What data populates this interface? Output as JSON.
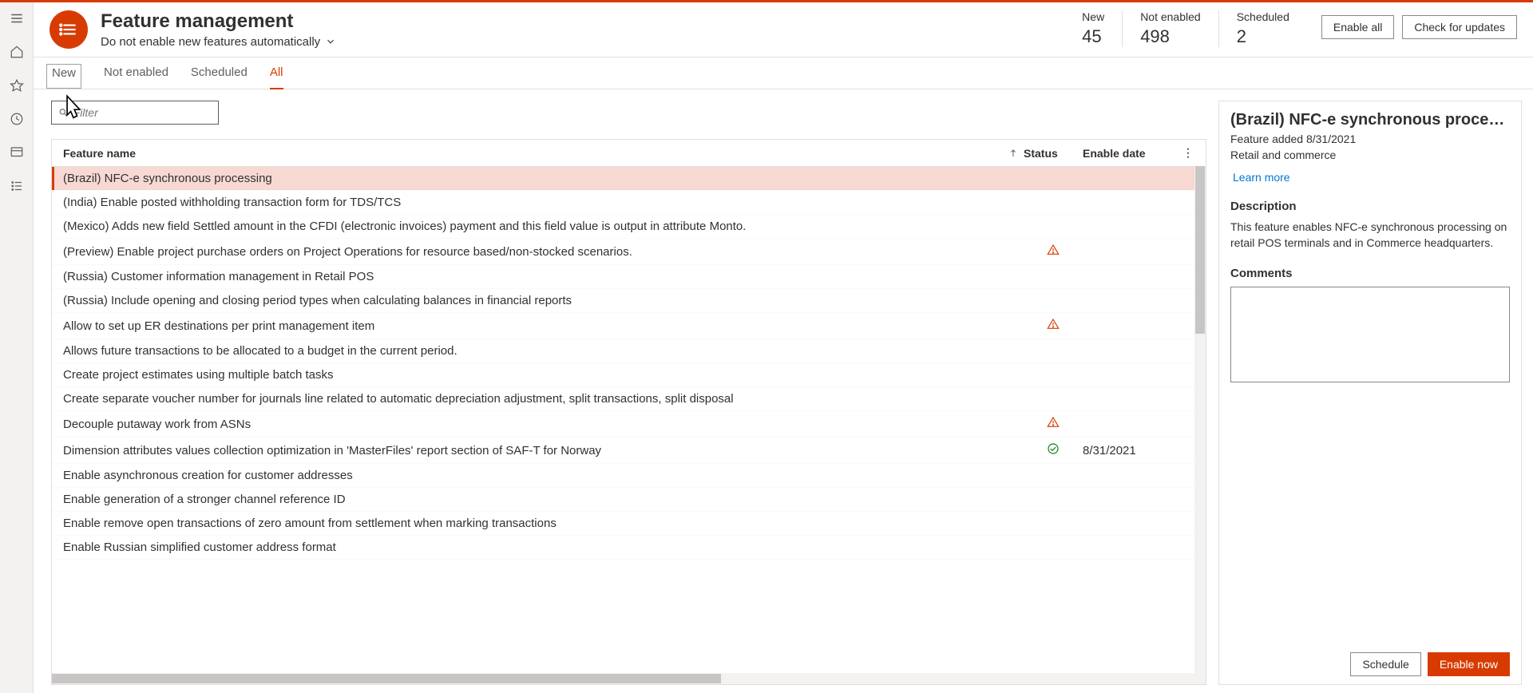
{
  "nav_rail": {
    "items": [
      "menu-icon",
      "home-icon",
      "star-icon",
      "recent-icon",
      "widget-icon",
      "list-icon"
    ]
  },
  "header": {
    "title": "Feature management",
    "subtitle": "Do not enable new features automatically",
    "stats": [
      {
        "label": "New",
        "value": "45"
      },
      {
        "label": "Not enabled",
        "value": "498"
      },
      {
        "label": "Scheduled",
        "value": "2"
      }
    ],
    "enable_all_label": "Enable all",
    "check_updates_label": "Check for updates"
  },
  "tabs": [
    {
      "label": "New",
      "active": false,
      "hover": true
    },
    {
      "label": "Not enabled",
      "active": false
    },
    {
      "label": "Scheduled",
      "active": false
    },
    {
      "label": "All",
      "active": true
    }
  ],
  "filter": {
    "placeholder": "Filter"
  },
  "columns": {
    "name": "Feature name",
    "status": "Status",
    "date": "Enable date"
  },
  "rows": [
    {
      "name": "(Brazil) NFC-e synchronous processing",
      "status": "",
      "date": "",
      "selected": true
    },
    {
      "name": "(India) Enable posted withholding transaction form for TDS/TCS",
      "status": "",
      "date": ""
    },
    {
      "name": "(Mexico) Adds new field Settled amount in the CFDI (electronic invoices) payment and this field value is output in attribute Monto.",
      "status": "",
      "date": ""
    },
    {
      "name": "(Preview) Enable project purchase orders on Project Operations for resource based/non-stocked scenarios.",
      "status": "warn",
      "date": ""
    },
    {
      "name": "(Russia) Customer information management in Retail POS",
      "status": "",
      "date": ""
    },
    {
      "name": "(Russia) Include opening and closing period types when calculating balances in financial reports",
      "status": "",
      "date": ""
    },
    {
      "name": "Allow to set up ER destinations per print management item",
      "status": "warn",
      "date": ""
    },
    {
      "name": "Allows future transactions to be allocated to a budget in the current period.",
      "status": "",
      "date": ""
    },
    {
      "name": "Create project estimates using multiple batch tasks",
      "status": "",
      "date": ""
    },
    {
      "name": "Create separate voucher number for journals line related to automatic depreciation adjustment, split transactions, split disposal",
      "status": "",
      "date": ""
    },
    {
      "name": "Decouple putaway work from ASNs",
      "status": "warn",
      "date": ""
    },
    {
      "name": "Dimension attributes values collection optimization in 'MasterFiles' report section of SAF-T for Norway",
      "status": "ok",
      "date": "8/31/2021"
    },
    {
      "name": "Enable asynchronous creation for customer addresses",
      "status": "",
      "date": ""
    },
    {
      "name": "Enable generation of a stronger channel reference ID",
      "status": "",
      "date": ""
    },
    {
      "name": "Enable remove open transactions of zero amount from settlement when marking transactions",
      "status": "",
      "date": ""
    },
    {
      "name": "Enable Russian simplified customer address format",
      "status": "",
      "date": ""
    }
  ],
  "detail": {
    "title": "(Brazil) NFC-e synchronous proce…",
    "added": "Feature added 8/31/2021",
    "module": "Retail and commerce",
    "link": "Learn more",
    "description_label": "Description",
    "description_text": "This feature enables NFC-e synchronous processing on retail POS terminals and in Commerce headquarters.",
    "comments_label": "Comments",
    "schedule_label": "Schedule",
    "enable_now_label": "Enable now"
  }
}
